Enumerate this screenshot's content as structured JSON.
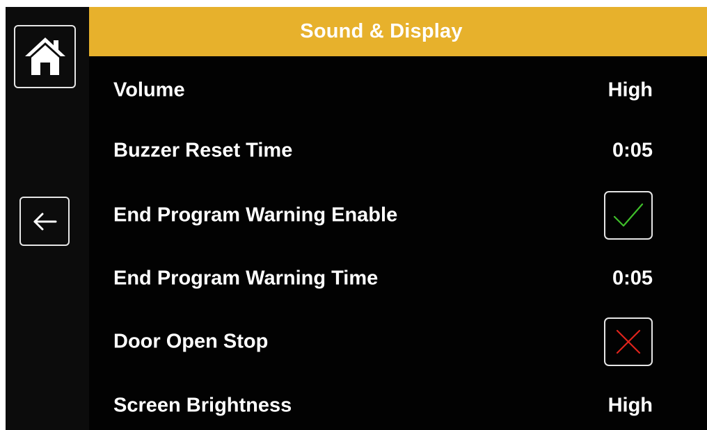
{
  "header": {
    "title": "Sound & Display"
  },
  "sidebar": {
    "home_icon": "home-icon",
    "back_icon": "arrow-left-icon"
  },
  "colors": {
    "header_bg": "#e7b12c",
    "screen_bg": "#020202",
    "text": "#ffffff",
    "check_green": "#3fbf2a",
    "cross_red": "#e0241c",
    "box_border": "#e6e6e6"
  },
  "settings": [
    {
      "label": "Volume",
      "type": "value",
      "value": "High"
    },
    {
      "label": "Buzzer Reset Time",
      "type": "value",
      "value": "0:05"
    },
    {
      "label": "End Program Warning Enable",
      "type": "checkbox",
      "checked": true,
      "icon": "checkmark-icon"
    },
    {
      "label": "End Program Warning Time",
      "type": "value",
      "value": "0:05"
    },
    {
      "label": "Door Open Stop",
      "type": "checkbox",
      "checked": false,
      "icon": "cross-icon"
    },
    {
      "label": "Screen Brightness",
      "type": "value",
      "value": "High"
    }
  ]
}
